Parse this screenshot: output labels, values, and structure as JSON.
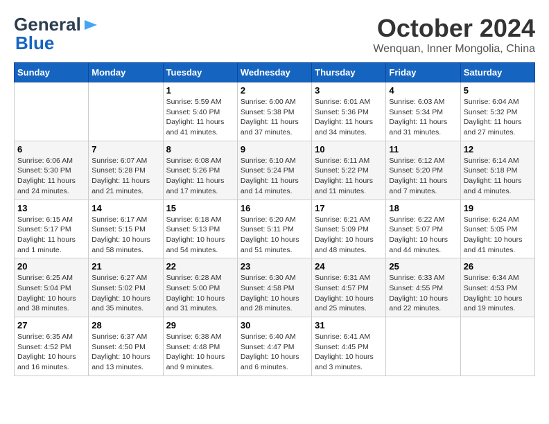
{
  "header": {
    "logo_general": "General",
    "logo_blue": "Blue",
    "month_title": "October 2024",
    "location": "Wenquan, Inner Mongolia, China"
  },
  "weekdays": [
    "Sunday",
    "Monday",
    "Tuesday",
    "Wednesday",
    "Thursday",
    "Friday",
    "Saturday"
  ],
  "weeks": [
    [
      {
        "day": "",
        "info": ""
      },
      {
        "day": "",
        "info": ""
      },
      {
        "day": "1",
        "info": "Sunrise: 5:59 AM\nSunset: 5:40 PM\nDaylight: 11 hours and 41 minutes."
      },
      {
        "day": "2",
        "info": "Sunrise: 6:00 AM\nSunset: 5:38 PM\nDaylight: 11 hours and 37 minutes."
      },
      {
        "day": "3",
        "info": "Sunrise: 6:01 AM\nSunset: 5:36 PM\nDaylight: 11 hours and 34 minutes."
      },
      {
        "day": "4",
        "info": "Sunrise: 6:03 AM\nSunset: 5:34 PM\nDaylight: 11 hours and 31 minutes."
      },
      {
        "day": "5",
        "info": "Sunrise: 6:04 AM\nSunset: 5:32 PM\nDaylight: 11 hours and 27 minutes."
      }
    ],
    [
      {
        "day": "6",
        "info": "Sunrise: 6:06 AM\nSunset: 5:30 PM\nDaylight: 11 hours and 24 minutes."
      },
      {
        "day": "7",
        "info": "Sunrise: 6:07 AM\nSunset: 5:28 PM\nDaylight: 11 hours and 21 minutes."
      },
      {
        "day": "8",
        "info": "Sunrise: 6:08 AM\nSunset: 5:26 PM\nDaylight: 11 hours and 17 minutes."
      },
      {
        "day": "9",
        "info": "Sunrise: 6:10 AM\nSunset: 5:24 PM\nDaylight: 11 hours and 14 minutes."
      },
      {
        "day": "10",
        "info": "Sunrise: 6:11 AM\nSunset: 5:22 PM\nDaylight: 11 hours and 11 minutes."
      },
      {
        "day": "11",
        "info": "Sunrise: 6:12 AM\nSunset: 5:20 PM\nDaylight: 11 hours and 7 minutes."
      },
      {
        "day": "12",
        "info": "Sunrise: 6:14 AM\nSunset: 5:18 PM\nDaylight: 11 hours and 4 minutes."
      }
    ],
    [
      {
        "day": "13",
        "info": "Sunrise: 6:15 AM\nSunset: 5:17 PM\nDaylight: 11 hours and 1 minute."
      },
      {
        "day": "14",
        "info": "Sunrise: 6:17 AM\nSunset: 5:15 PM\nDaylight: 10 hours and 58 minutes."
      },
      {
        "day": "15",
        "info": "Sunrise: 6:18 AM\nSunset: 5:13 PM\nDaylight: 10 hours and 54 minutes."
      },
      {
        "day": "16",
        "info": "Sunrise: 6:20 AM\nSunset: 5:11 PM\nDaylight: 10 hours and 51 minutes."
      },
      {
        "day": "17",
        "info": "Sunrise: 6:21 AM\nSunset: 5:09 PM\nDaylight: 10 hours and 48 minutes."
      },
      {
        "day": "18",
        "info": "Sunrise: 6:22 AM\nSunset: 5:07 PM\nDaylight: 10 hours and 44 minutes."
      },
      {
        "day": "19",
        "info": "Sunrise: 6:24 AM\nSunset: 5:05 PM\nDaylight: 10 hours and 41 minutes."
      }
    ],
    [
      {
        "day": "20",
        "info": "Sunrise: 6:25 AM\nSunset: 5:04 PM\nDaylight: 10 hours and 38 minutes."
      },
      {
        "day": "21",
        "info": "Sunrise: 6:27 AM\nSunset: 5:02 PM\nDaylight: 10 hours and 35 minutes."
      },
      {
        "day": "22",
        "info": "Sunrise: 6:28 AM\nSunset: 5:00 PM\nDaylight: 10 hours and 31 minutes."
      },
      {
        "day": "23",
        "info": "Sunrise: 6:30 AM\nSunset: 4:58 PM\nDaylight: 10 hours and 28 minutes."
      },
      {
        "day": "24",
        "info": "Sunrise: 6:31 AM\nSunset: 4:57 PM\nDaylight: 10 hours and 25 minutes."
      },
      {
        "day": "25",
        "info": "Sunrise: 6:33 AM\nSunset: 4:55 PM\nDaylight: 10 hours and 22 minutes."
      },
      {
        "day": "26",
        "info": "Sunrise: 6:34 AM\nSunset: 4:53 PM\nDaylight: 10 hours and 19 minutes."
      }
    ],
    [
      {
        "day": "27",
        "info": "Sunrise: 6:35 AM\nSunset: 4:52 PM\nDaylight: 10 hours and 16 minutes."
      },
      {
        "day": "28",
        "info": "Sunrise: 6:37 AM\nSunset: 4:50 PM\nDaylight: 10 hours and 13 minutes."
      },
      {
        "day": "29",
        "info": "Sunrise: 6:38 AM\nSunset: 4:48 PM\nDaylight: 10 hours and 9 minutes."
      },
      {
        "day": "30",
        "info": "Sunrise: 6:40 AM\nSunset: 4:47 PM\nDaylight: 10 hours and 6 minutes."
      },
      {
        "day": "31",
        "info": "Sunrise: 6:41 AM\nSunset: 4:45 PM\nDaylight: 10 hours and 3 minutes."
      },
      {
        "day": "",
        "info": ""
      },
      {
        "day": "",
        "info": ""
      }
    ]
  ]
}
